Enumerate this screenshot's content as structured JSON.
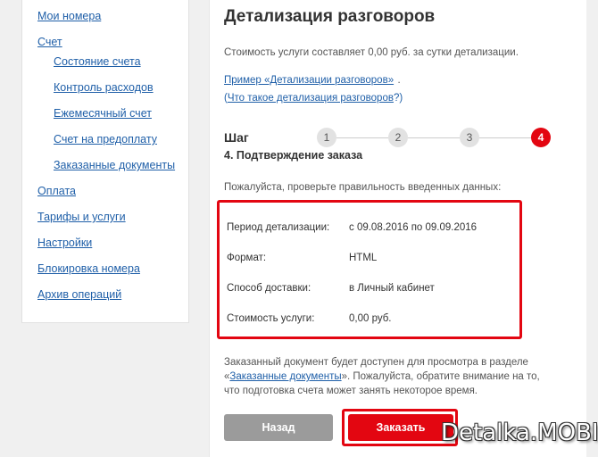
{
  "sidebar": {
    "items": [
      {
        "label": "Мои номера"
      },
      {
        "label": "Счет"
      },
      {
        "label": "Состояние счета"
      },
      {
        "label": "Контроль расходов"
      },
      {
        "label": "Ежемесячный счет"
      },
      {
        "label": "Счет на предоплату"
      },
      {
        "label": "Заказанные документы"
      },
      {
        "label": "Оплата"
      },
      {
        "label": "Тарифы и услуги"
      },
      {
        "label": "Настройки"
      },
      {
        "label": "Блокировка номера"
      },
      {
        "label": "Архив операций"
      }
    ]
  },
  "main": {
    "title": "Детализация разговоров",
    "cost_text": "Стоимость услуги составляет 0,00 руб. за сутки детализации.",
    "example_link": "Пример «Детализации разговоров»",
    "example_suffix": ".",
    "what_link_open": "(",
    "what_link": "Что такое детализация разговоров",
    "what_link_close": "?)",
    "step_label": "Шаг",
    "steps": [
      "1",
      "2",
      "3",
      "4"
    ],
    "active_step": 4,
    "step_title": "4. Подтверждение заказа",
    "check_text": "Пожалуйста, проверьте правильность введенных данных:",
    "details": {
      "period_label": "Период детализации:",
      "period_value": "с 09.08.2016 по 09.09.2016",
      "format_label": "Формат:",
      "format_value": "HTML",
      "delivery_label": "Способ доставки:",
      "delivery_value": "в Личный кабинет",
      "cost_label": "Стоимость услуги:",
      "cost_value": "0,00 руб."
    },
    "note_before": "Заказанный документ будет доступен для просмотра в разделе «",
    "note_link": "Заказанные документы",
    "note_after": "». Пожалуйста, обратите внимание на то, что подготовка счета может занять некоторое время.",
    "back_button": "Назад",
    "order_button": "Заказать"
  },
  "watermark": "Detalka.MOBI",
  "colors": {
    "accent": "#e30611",
    "link": "#1f5fa8",
    "back_button": "#9b9b9b"
  }
}
